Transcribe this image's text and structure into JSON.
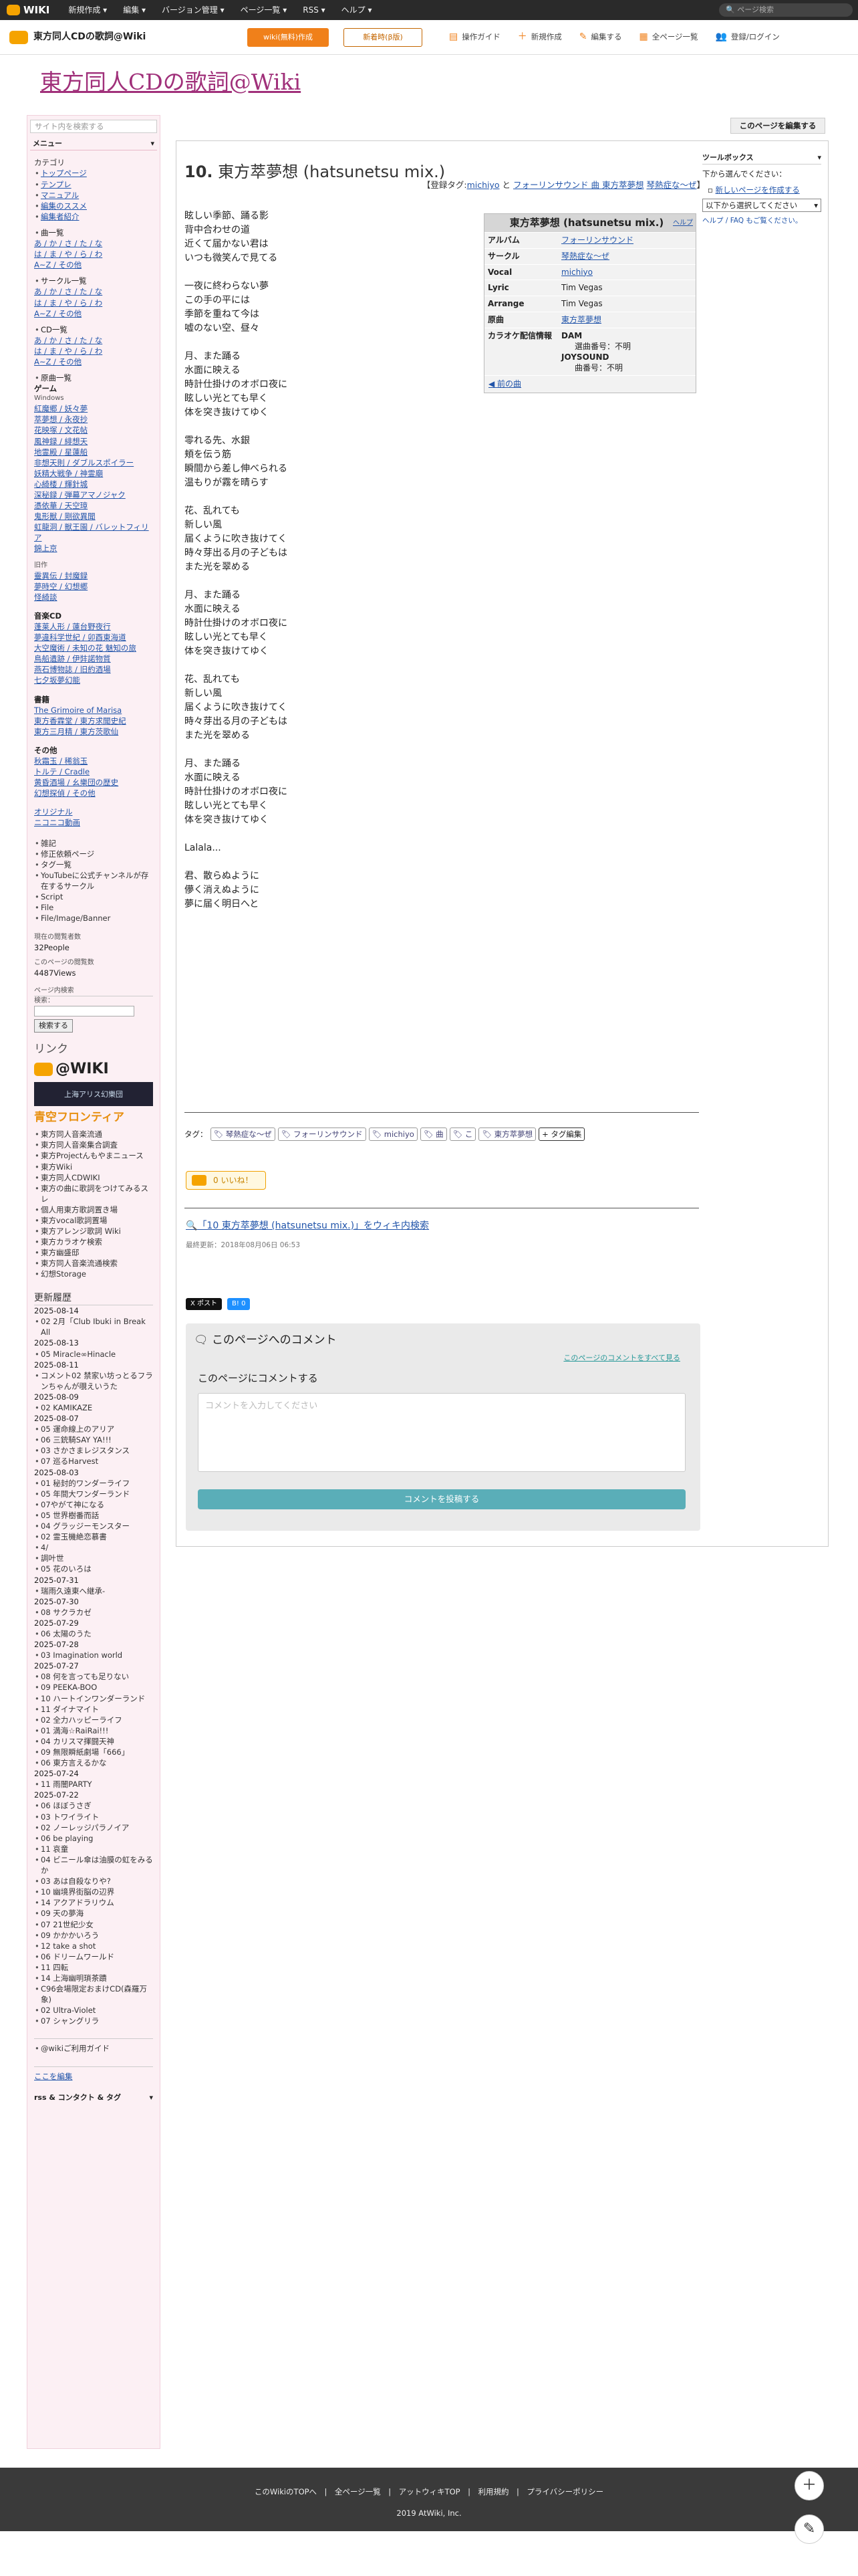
{
  "topbar": {
    "logo": "WIKI",
    "menu": [
      "新規作成 ▾",
      "編集 ▾",
      "バージョン管理 ▾",
      "ページ一覧 ▾",
      "RSS ▾",
      "ヘルプ ▾"
    ],
    "search_placeholder": "ページ検索"
  },
  "header": {
    "site_name": "東方同人CDの歌詞@Wiki",
    "wiki_btn": "wiki(無料)作成",
    "news_btn": "新着時(β版)",
    "links": [
      "操作ガイド",
      "新規作成",
      "編集する",
      "全ページ一覧",
      "登録/ログイン"
    ]
  },
  "title": "東方同人CDの歌詞@Wiki",
  "edit_page_btn": "このページを編集する",
  "sidebar": {
    "search_placeholder": "サイト内を検索する",
    "menu_label": "メニュー",
    "category_head": "カテゴリ",
    "category_items": [
      "トップページ",
      "テンプレ",
      "マニュアル",
      "編集のススメ",
      "編集者紹介"
    ],
    "song_head": "曲一覧",
    "song_rows": [
      "あ / か / さ / た / な",
      "は / ま / や / ら / わ",
      "A~Z / その他"
    ],
    "circle_head": "サークル一覧",
    "circle_rows": [
      "あ / か / さ / た / な",
      "は / ま / や / ら / わ",
      "A~Z / その他"
    ],
    "cd_head": "CD一覧",
    "cd_rows": [
      "あ / か / さ / た / な",
      "は / ま / や / ら / わ",
      "A~Z / その他"
    ],
    "orig_head": "原曲一覧",
    "game_head": "ゲーム",
    "win_head": "Windows",
    "win_rows": [
      "紅魔郷 / 妖々夢",
      "萃夢想 / 永夜抄",
      "花映塚 / 文花帖",
      "風神録 / 緋想天",
      "地霊殿 / 星蓮船",
      "非想天則 / ダブルスポイラー",
      "妖精大戦争 / 神霊廟",
      "心綺楼 / 輝針城",
      "深秘録 / 弾幕アマノジャク",
      "憑依華 / 天空璋",
      "鬼形獣 / 剛欲異聞",
      "虹龍洞 / 獣王園 / バレットフィリア",
      "錦上京"
    ],
    "old_head": "旧作",
    "old_rows": [
      "靈異伝 / 封魔録",
      "夢時空 / 幻想郷",
      "怪綺談"
    ],
    "music_head": "音楽CD",
    "music_rows": [
      "蓬莱人形 / 蓮台野夜行",
      "夢違科学世紀 / 卯酉東海道",
      "大空魔術 / 未知の花 魅知の旅",
      "鳥船遺跡 / 伊弉諾物質",
      "燕石博物誌 / 旧約酒場",
      "七夕坂夢幻能"
    ],
    "book_head": "書籍",
    "book_rows": [
      "The Grimoire of Marisa",
      "東方香霖堂 / 東方求聞史紀",
      "東方三月精 / 東方茨歌仙"
    ],
    "other_head": "その他",
    "other_rows": [
      "秋霜玉 / 稀翁玉",
      "トルテ / Cradle",
      "黄昏酒場 / 幺樂団の歴史",
      "幻想探偵 / その他"
    ],
    "misc": [
      "オリジナル",
      "ニコニコ動画"
    ],
    "misc2": [
      "雑記",
      "修正依頼ページ",
      "タグ一覧",
      "YouTubeに公式チャンネルが存在するサークル",
      "Script",
      "File",
      "File/Image/Banner"
    ],
    "now_label": "現在の閲覧者数",
    "now_value": "32People",
    "views_label": "このページの閲覧数",
    "views_value": "4487Views",
    "pv_label": "ページ内検索",
    "pv_sub": "検索：",
    "pv_btn": "検索する",
    "link_head": "リンク",
    "link_banners": [
      "@WIKI",
      "上海アリス幻樂団",
      "青空フロンティア"
    ],
    "link_items": [
      "東方同人音楽流通",
      "東方同人音楽集合調査",
      "東方Projectんもやまニュース",
      "東方Wiki",
      "東方同人CDWIKI",
      "東方の曲に歌詞をつけてみるスレ",
      "個人用東方歌詞置き場",
      "東方vocal歌詞置場",
      "東方アレンジ歌詞 Wiki",
      "東方カラオケ検索",
      "東方幽盛邸",
      "東方同人音楽流通検索",
      "幻想Storage"
    ],
    "recent_head": "更新履歴",
    "recent": [
      {
        "d": "2025-08-14",
        "i": [
          "02 2月「Club Ibuki in Break All"
        ]
      },
      {
        "d": "2025-08-13",
        "i": [
          "05 Miracle∞Hinacle"
        ]
      },
      {
        "d": "2025-08-11",
        "i": [
          "コメント02 禁家い坊っとるフランちゃんが覗えいうた"
        ]
      },
      {
        "d": "2025-08-09",
        "i": [
          "02 KAMIKAZE"
        ]
      },
      {
        "d": "2025-08-07",
        "i": [
          "05 運命線上のアリア",
          "06 三銃騎SAY YA!!!",
          "03 さかさまレジスタンス",
          "07 巡るHarvest"
        ]
      },
      {
        "d": "2025-08-03",
        "i": [
          "01 秘封的ワンダーライフ",
          "05 年間大ワンダーランド",
          "07やがて神になる",
          "05 世界樹番而話",
          "04 グラッジーモンスター",
          "02 霊玉機絶恋慕書",
          "4/",
          "調叶世",
          "05 花のいろは"
        ]
      },
      {
        "d": "2025-07-31",
        "i": [
          "瑞雨久遠東へ継承-"
        ]
      },
      {
        "d": "2025-07-30",
        "i": [
          "08 サクラカゼ"
        ]
      },
      {
        "d": "2025-07-29",
        "i": [
          "06 太陽のうた"
        ]
      },
      {
        "d": "2025-07-28",
        "i": [
          "03 Imagination world"
        ]
      },
      {
        "d": "2025-07-27",
        "i": [
          "08 何を言っても足りない",
          "09 PEEKA-BOO",
          "10 ハートインワンダーランド",
          "11 ダイナマイト",
          "02 全力ハッピーライフ",
          "01 満海☆RaiRai!!!",
          "04 カリスマ揮闘天神",
          "09 無限瞬紙劇場「666」",
          "06 東方言えるかな"
        ]
      },
      {
        "d": "2025-07-24",
        "i": [
          "11 雨闇PARTY"
        ]
      },
      {
        "d": "2025-07-22",
        "i": [
          "06 ほぼうさぎ",
          "03 トワイライト",
          "02 ノーレッジパラノイア",
          "06 be playing",
          "11 哀童",
          "04 ビニール傘は油膜の虹をみるか",
          "03 あは自殺なりや?",
          "10 幽境界街脳の辺界",
          "14 アクアドラリウム",
          "09 天の夢海",
          "07 21世紀少女",
          "09 かかかいろう",
          "12 take a shot",
          "06 ドリームワールド",
          "11 四転",
          "14 上海幽明瑣茶蹟",
          "C96会場限定おまけCD(森羅万象)",
          "02 Ultra-Violet",
          "07 シャングリラ"
        ]
      }
    ],
    "guide": "@wikiご利用ガイド",
    "edit_here": "ここを編集",
    "rss": "rss & コンタクト & タグ"
  },
  "content": {
    "num": "10.",
    "song_title": "東方萃夢想 (hatsunetsu mix.)",
    "tag_prefix": "【登録タグ:",
    "tag_michiyo": "michiyo",
    "tag_to": " と ",
    "tag_fs": "フォーリンサウンド",
    "tag_kyoku": " 曲 ",
    "tag_ts": "東方萃夢想",
    "tag_kai": "琴熱症な～ぜ",
    "tag_close": "】",
    "lyrics": [
      [
        "眩しい季節、踊る影",
        "背中合わせの道",
        "近くて届かない君は",
        "いつも微笑んで見てる"
      ],
      [
        "一夜に終わらない夢",
        "この手の平には",
        "季節を重ねて今は",
        "嘘のない空、昼々"
      ],
      [
        "月、また踊る",
        "水面に映える",
        "時計仕掛けのオボロ夜に",
        "眩しい光とても早く",
        "体を突き抜けてゆく"
      ],
      [
        "零れる先、水銀",
        "頬を伝う筋",
        "瞬間から差し伸べられる",
        "温もりが霧を晴らす"
      ],
      [
        "花、乱れても",
        "新しい風",
        "届くように吹き抜けてく",
        "時々芽出る月の子どもは",
        "また光を翠める"
      ],
      [
        "月、また踊る",
        "水面に映える",
        "時計仕掛けのオボロ夜に",
        "眩しい光とても早く",
        "体を突き抜けてゆく"
      ],
      [
        "花、乱れても",
        "新しい風",
        "届くように吹き抜けてく",
        "時々芽出る月の子どもは",
        "また光を翠める"
      ],
      [
        "月、また踊る",
        "水面に映える",
        "時計仕掛けのオボロ夜に",
        "眩しい光とても早く",
        "体を突き抜けてゆく"
      ],
      [
        "Lalala..."
      ],
      [
        "君、散らぬように",
        "儚く消えぬように",
        "夢に届く明日へと"
      ]
    ],
    "infobox": {
      "title": "東方萃夢想 (hatsunetsu mix.)",
      "help": "ヘルプ",
      "rows": [
        {
          "k": "アルバム",
          "v": "フォーリンサウンド",
          "link": true
        },
        {
          "k": "サークル",
          "v": "琴熱症な～ぜ",
          "link": true
        },
        {
          "k": "Vocal",
          "v": "michiyo",
          "link": true
        },
        {
          "k": "Lyric",
          "v": "Tim Vegas",
          "link": false
        },
        {
          "k": "Arrange",
          "v": "Tim Vegas",
          "link": false
        },
        {
          "k": "原曲",
          "v": "東方萃夢想",
          "link": true
        }
      ],
      "karaoke_k": "カラオケ配信情報",
      "dam": "DAM",
      "dam_no": "選曲番号：不明",
      "joy": "JOYSOUND",
      "joy_no": "曲番号：不明",
      "back": "◀ 前の曲"
    },
    "toolbox": {
      "head": "ツールボックス",
      "desc": "下から選んでください：",
      "new": "新しいページを作成する",
      "select": "以下から選択してください",
      "help": "ヘルプ / FAQ もご覧ください。"
    },
    "tags_label": "タグ：",
    "tags": [
      "琴熱症な～ぜ",
      "フォーリンサウンド",
      "michiyo",
      "曲",
      "こ",
      "東方萃夢想"
    ],
    "tag_edit": "+ タグ編集",
    "iine": "0 いいね！",
    "search_link": "「10 東方萃夢想 (hatsunetsu mix.)」をウィキ内検索",
    "updated": "最終更新：2018年08月06日 06:53",
    "share_x": "X ポスト",
    "share_b": "B! 0",
    "comment": {
      "title": "このページへのコメント",
      "all": "このページのコメントをすべて見る",
      "label": "このページにコメントする",
      "placeholder": "コメントを入力してください",
      "post": "コメントを投稿する"
    }
  },
  "footer": {
    "links": "このWikiのTOPへ　|　全ページ一覧　|　アットウィキTOP　|　利用規約　|　プライバシーポリシー",
    "copy": "2019 AtWiki, Inc."
  }
}
